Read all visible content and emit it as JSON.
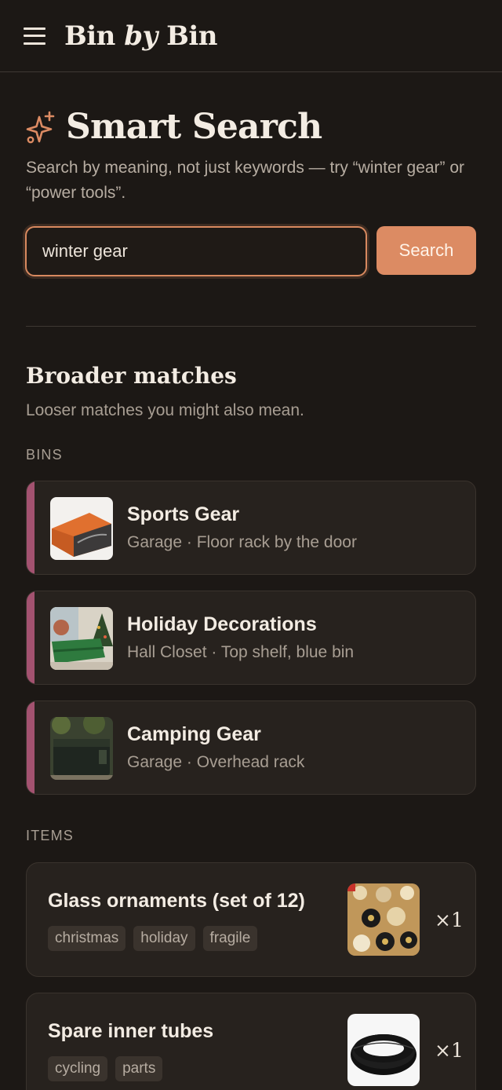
{
  "header": {
    "brand_pre": "Bin ",
    "brand_by": "by",
    "brand_post": " Bin"
  },
  "page": {
    "title": "Smart Search",
    "subtitle": "Search by meaning, not just keywords — try “winter gear” or “power tools”."
  },
  "search": {
    "value": "winter gear",
    "button_label": "Search"
  },
  "broader": {
    "title": "Broader matches",
    "subtitle": "Looser matches you might also mean.",
    "bins_label": "BINS",
    "items_label": "ITEMS"
  },
  "bins": [
    {
      "name": "Sports Gear",
      "location": "Garage · Floor rack by the door"
    },
    {
      "name": "Holiday Decorations",
      "location": "Hall Closet · Top shelf, blue bin"
    },
    {
      "name": "Camping Gear",
      "location": "Garage · Overhead rack"
    }
  ],
  "items": [
    {
      "name": "Glass ornaments (set of 12)",
      "tags": [
        "christmas",
        "holiday",
        "fragile"
      ],
      "qty": "×1"
    },
    {
      "name": "Spare inner tubes",
      "tags": [
        "cycling",
        "parts"
      ],
      "qty": "×1"
    }
  ],
  "colors": {
    "background": "#1c1815",
    "accent": "#dc8b63",
    "bin_stripe": "#a35270",
    "card": "#27221e"
  },
  "icons": {
    "menu": "hamburger-icon",
    "title": "sparkle-icon"
  }
}
